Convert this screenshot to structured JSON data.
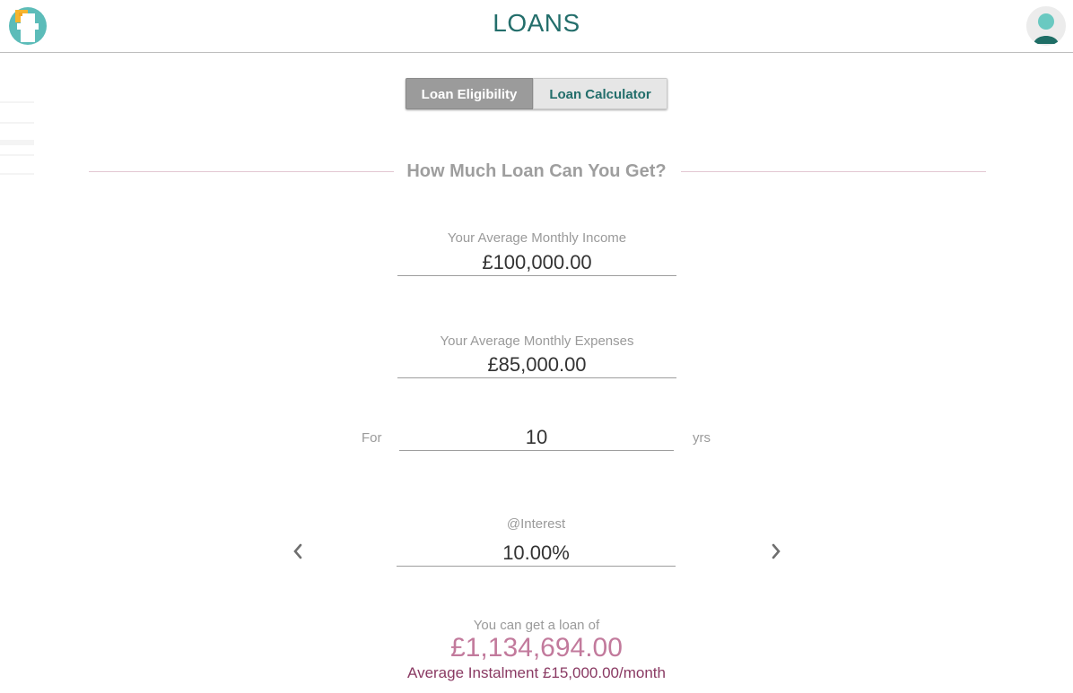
{
  "header": {
    "title": "LOANS",
    "logo_icon": "cash-register-icon",
    "avatar_icon": "user-avatar-icon"
  },
  "tabs": [
    {
      "label": "Loan Eligibility",
      "active": true
    },
    {
      "label": "Loan Calculator",
      "active": false
    }
  ],
  "section": {
    "title": "How Much Loan Can You Get?"
  },
  "form": {
    "income": {
      "label": "Your Average Monthly Income",
      "value": "£100,000.00"
    },
    "expenses": {
      "label": "Your Average Monthly Expenses",
      "value": "£85,000.00"
    },
    "term": {
      "prefix": "For",
      "value": "10",
      "suffix": "yrs"
    },
    "interest": {
      "label": "@Interest",
      "value": "10.00%"
    }
  },
  "result": {
    "label": "You can get a loan of",
    "amount": "£1,134,694.00",
    "instalment": "Average Instalment £15,000.00/month"
  },
  "colors": {
    "brand": "#236e6b",
    "accent": "#c27a9c",
    "instalment": "#8a3a63",
    "tab_active_bg": "#9b9b9b",
    "tab_inactive_bg": "#e6e6e6"
  }
}
